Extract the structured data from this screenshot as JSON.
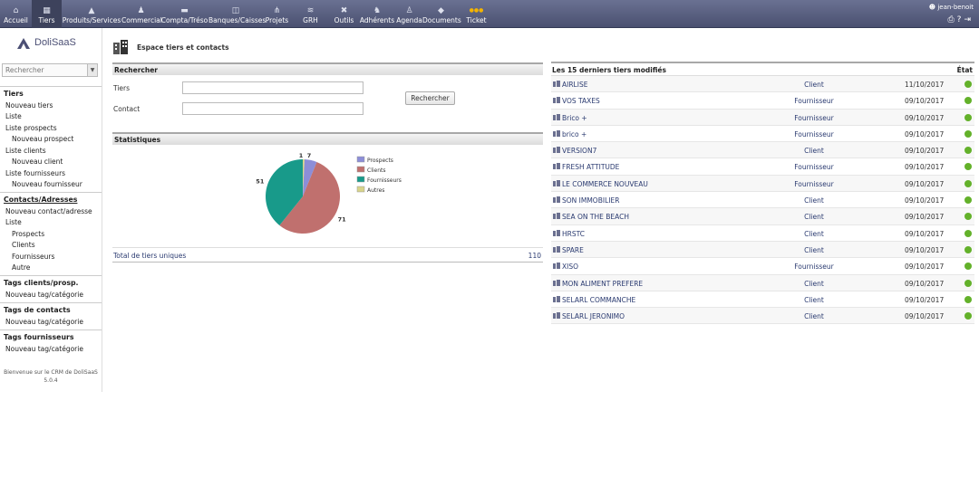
{
  "topmenu": [
    {
      "label": "Accueil",
      "icon": "home-icon",
      "glyph": "⌂"
    },
    {
      "label": "Tiers",
      "icon": "building-icon",
      "glyph": "▦",
      "active": true
    },
    {
      "label": "Produits/Services",
      "icon": "cubes-icon",
      "glyph": "▲"
    },
    {
      "label": "Commercial",
      "icon": "person-icon",
      "glyph": "♟"
    },
    {
      "label": "Compta/Tréso",
      "icon": "wallet-icon",
      "glyph": "▬"
    },
    {
      "label": "Banques/Caisses",
      "icon": "bank-icon",
      "glyph": "◫"
    },
    {
      "label": "Projets",
      "icon": "sitemap-icon",
      "glyph": "⋔"
    },
    {
      "label": "GRH",
      "icon": "briefcase-icon",
      "glyph": "≋"
    },
    {
      "label": "Outils",
      "icon": "tools-icon",
      "glyph": "✖"
    },
    {
      "label": "Adhérents",
      "icon": "members-icon",
      "glyph": "♞"
    },
    {
      "label": "Agenda",
      "icon": "calendar-icon",
      "glyph": "♙"
    },
    {
      "label": "Documents",
      "icon": "documents-icon",
      "glyph": "◆"
    },
    {
      "label": "Ticket",
      "icon": "ticket-icon",
      "glyph": "●●●"
    }
  ],
  "user": {
    "name": "jean-benoit",
    "icons": [
      "print-icon",
      "help-icon",
      "logout-icon"
    ]
  },
  "sidebar": {
    "logo_text": "DoliSaaS",
    "search_placeholder": "Rechercher",
    "sections": [
      {
        "title": "Tiers",
        "underline": false,
        "items": [
          {
            "label": "Nouveau tiers",
            "sub": false
          },
          {
            "label": "Liste",
            "sub": false
          },
          {
            "label": "Liste prospects",
            "sub": false
          },
          {
            "label": "Nouveau prospect",
            "sub": true
          },
          {
            "label": "Liste clients",
            "sub": false
          },
          {
            "label": "Nouveau client",
            "sub": true
          },
          {
            "label": "Liste fournisseurs",
            "sub": false
          },
          {
            "label": "Nouveau fournisseur",
            "sub": true
          }
        ]
      },
      {
        "title": "Contacts/Adresses",
        "underline": true,
        "items": [
          {
            "label": "Nouveau contact/adresse",
            "sub": false
          },
          {
            "label": "Liste",
            "sub": false
          },
          {
            "label": "Prospects",
            "sub": true
          },
          {
            "label": "Clients",
            "sub": true
          },
          {
            "label": "Fournisseurs",
            "sub": true
          },
          {
            "label": "Autre",
            "sub": true
          }
        ]
      },
      {
        "title": "Tags clients/prosp.",
        "underline": false,
        "items": [
          {
            "label": "Nouveau tag/catégorie",
            "sub": false
          }
        ]
      },
      {
        "title": "Tags de contacts",
        "underline": false,
        "items": [
          {
            "label": "Nouveau tag/catégorie",
            "sub": false
          }
        ]
      },
      {
        "title": "Tags fournisseurs",
        "underline": false,
        "items": [
          {
            "label": "Nouveau tag/catégorie",
            "sub": false
          }
        ]
      }
    ],
    "welcome_line1": "Bienvenue sur le CRM de DoliSaaS",
    "welcome_line2": "5.0.4"
  },
  "page": {
    "title": "Espace tiers et contacts"
  },
  "search": {
    "header": "Rechercher",
    "tiers_label": "Tiers",
    "contact_label": "Contact",
    "button": "Rechercher"
  },
  "stats": {
    "header": "Statistiques",
    "total_label": "Total de tiers uniques",
    "total_value": "110"
  },
  "chart_data": {
    "type": "pie",
    "labels": [
      "Prospects",
      "Clients",
      "Fournisseurs",
      "Autres"
    ],
    "values": [
      7,
      71,
      51,
      1
    ],
    "colors": [
      "#8c8ed8",
      "#c0706e",
      "#189a8a",
      "#d8d48a"
    ],
    "legend_position": "right"
  },
  "recent": {
    "header": "Les 15 derniers tiers modifiés",
    "state_header": "État",
    "rows": [
      {
        "name": "AIRLISE",
        "type": "Client",
        "date": "11/10/2017"
      },
      {
        "name": "VOS TAXES",
        "type": "Fournisseur",
        "date": "09/10/2017"
      },
      {
        "name": "Brico +",
        "type": "Fournisseur",
        "date": "09/10/2017"
      },
      {
        "name": "brico +",
        "type": "Fournisseur",
        "date": "09/10/2017"
      },
      {
        "name": "VERSION7",
        "type": "Client",
        "date": "09/10/2017"
      },
      {
        "name": "FRESH ATTITUDE",
        "type": "Fournisseur",
        "date": "09/10/2017"
      },
      {
        "name": "LE COMMERCE NOUVEAU",
        "type": "Fournisseur",
        "date": "09/10/2017"
      },
      {
        "name": "SON IMMOBILIER",
        "type": "Client",
        "date": "09/10/2017"
      },
      {
        "name": "SEA ON THE BEACH",
        "type": "Client",
        "date": "09/10/2017"
      },
      {
        "name": "HRSTC",
        "type": "Client",
        "date": "09/10/2017"
      },
      {
        "name": "SPARE",
        "type": "Client",
        "date": "09/10/2017"
      },
      {
        "name": "XISO",
        "type": "Fournisseur",
        "date": "09/10/2017"
      },
      {
        "name": "MON ALIMENT PREFERE",
        "type": "Client",
        "date": "09/10/2017"
      },
      {
        "name": "SELARL COMMANCHE",
        "type": "Client",
        "date": "09/10/2017"
      },
      {
        "name": "SELARL JERONIMO",
        "type": "Client",
        "date": "09/10/2017"
      }
    ],
    "status_color": "#63b12a"
  }
}
